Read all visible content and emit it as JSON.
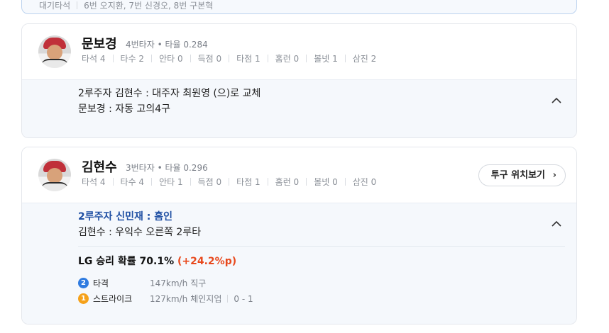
{
  "top_card": {
    "label": "대기타석",
    "detail": "6번 오지환, 7번 신경오, 8번 구본혁"
  },
  "batters": [
    {
      "name": "문보경",
      "meta": "4번타자 • 타율 0.284",
      "stats": [
        "타석 4",
        "타수 2",
        "안타 0",
        "득점 0",
        "타점 1",
        "홈런 0",
        "볼넷 1",
        "삼진 2"
      ],
      "events": [
        "2루주자 김현수 : 대주자 최원영 (으)로 교체",
        "문보경 : 자동 고의4구"
      ]
    },
    {
      "name": "김현수",
      "meta": "3번타자 • 타율 0.296",
      "stats": [
        "타석 4",
        "타수 4",
        "안타 1",
        "득점 0",
        "타점 1",
        "홈런 0",
        "볼넷 0",
        "삼진 0"
      ],
      "button_label": "투구 위치보기",
      "events": [
        "2루주자 신민재 : 홈인",
        "김현수 : 우익수 오른쪽 2루타"
      ],
      "win_prob_label": "LG 승리 확률 70.1%",
      "win_prob_delta": "(+24.2%p)",
      "pitches": [
        {
          "num": "2",
          "type": "타격",
          "speed": "147km/h",
          "pitch": "직구",
          "count": "",
          "color": "#2f7be0"
        },
        {
          "num": "1",
          "type": "스트라이크",
          "speed": "127km/h",
          "pitch": "체인지업",
          "count": "0 - 1",
          "color": "#f5a11a"
        }
      ]
    }
  ]
}
